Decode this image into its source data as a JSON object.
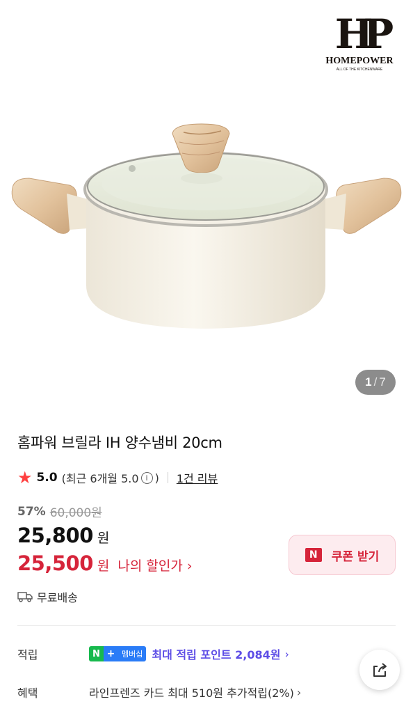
{
  "gallery": {
    "logo_monogram": "HP",
    "logo_brand": "HOMEPOWER",
    "logo_tagline": "ALL OF THE KITCHENWARE",
    "counter_current": "1",
    "counter_sep": "/",
    "counter_total": "7"
  },
  "product": {
    "title": "홈파워 브릴라 IH 양수냄비 20cm",
    "rating_score": "5.0",
    "rating_recent": "(최근 6개월 5.0",
    "rating_recent_close": ")",
    "info_icon": "ⓘ",
    "reviews_link": "1건 리뷰"
  },
  "price": {
    "discount_pct": "57%",
    "original": "60,000원",
    "sale_value": "25,800",
    "sale_unit": "원",
    "my_price_value": "25,500",
    "my_price_unit": "원",
    "my_price_label": "나의 할인가",
    "chevron": "›",
    "coupon_badge": "N",
    "coupon_label": "쿠폰 받기"
  },
  "shipping": {
    "label": "무료배송"
  },
  "benefits": {
    "points_key": "적립",
    "membership_n": "N",
    "membership_plus": "+",
    "membership_label": "멤버십",
    "points_value": "최대 적립 포인트 2,084원",
    "perks_key": "혜택",
    "perks_value": "라인프렌즈 카드 최대 510원 추가적립(2%)",
    "chevron": "›"
  },
  "icons": {
    "star": "star-icon",
    "truck": "truck-icon",
    "share": "share-icon"
  },
  "colors": {
    "accent_red": "#d6243a",
    "star_red": "#ff4040",
    "membership_purple": "#5d4de6",
    "naver_green": "#17b94d",
    "plus_blue": "#2a7cf7"
  }
}
